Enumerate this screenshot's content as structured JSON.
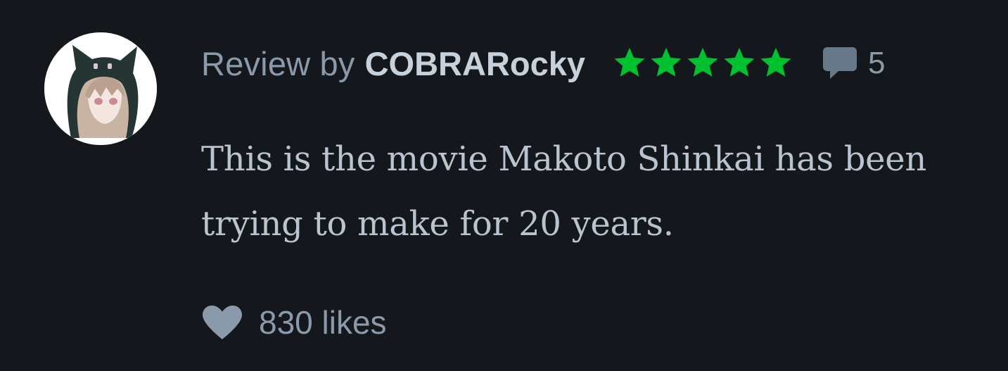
{
  "review": {
    "prefix": "Review by",
    "username": "COBRARocky",
    "rating_stars": 5,
    "rating_max": 5,
    "comment_count": "5",
    "text": "This is the movie Makoto Shinkai has been trying to make for 20 years.",
    "likes": "830 likes"
  },
  "icons": {
    "avatar": "user-avatar",
    "stars": "star-icon",
    "comments": "speech-bubble-icon",
    "likes": "heart-icon"
  },
  "colors": {
    "background": "#14181c",
    "star": "#00c030",
    "muted_text": "#8a9aab",
    "username": "#c7d1dc",
    "body_text": "#b9c4d0"
  }
}
